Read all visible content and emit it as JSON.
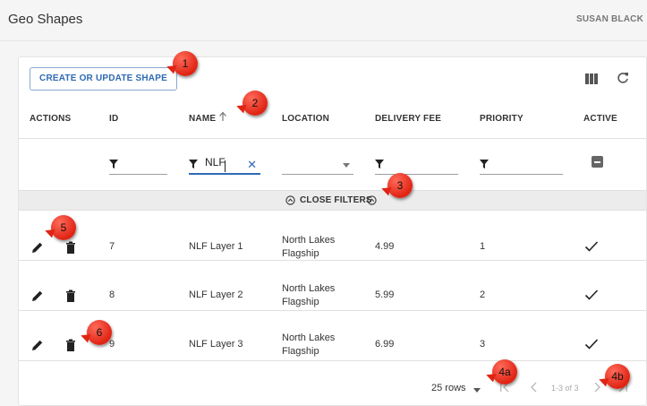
{
  "app": {
    "title": "Geo Shapes",
    "user": "SUSAN BLACK"
  },
  "toolbar": {
    "create_label": "CREATE OR UPDATE SHAPE"
  },
  "columns": [
    "ACTIONS",
    "ID",
    "NAME",
    "LOCATION",
    "DELIVERY FEE",
    "PRIORITY",
    "ACTIVE"
  ],
  "filters": {
    "name_value": "NLF"
  },
  "close_filters_label": "CLOSE FILTERS",
  "rows": [
    {
      "id": "7",
      "name": "NLF Layer 1",
      "location_1": "North Lakes",
      "location_2": "Flagship",
      "fee": "4.99",
      "priority": "1"
    },
    {
      "id": "8",
      "name": "NLF Layer 2",
      "location_1": "North Lakes",
      "location_2": "Flagship",
      "fee": "5.99",
      "priority": "2"
    },
    {
      "id": "9",
      "name": "NLF Layer 3",
      "location_1": "North Lakes",
      "location_2": "Flagship",
      "fee": "6.99",
      "priority": "3"
    }
  ],
  "pagination": {
    "rows_label": "25 rows",
    "range": "1-3 of 3"
  },
  "callouts": [
    "1",
    "2",
    "3",
    "4a",
    "4b",
    "5",
    "6"
  ],
  "colors": {
    "accent": "#2f6ab3",
    "callout": "#e02414"
  }
}
